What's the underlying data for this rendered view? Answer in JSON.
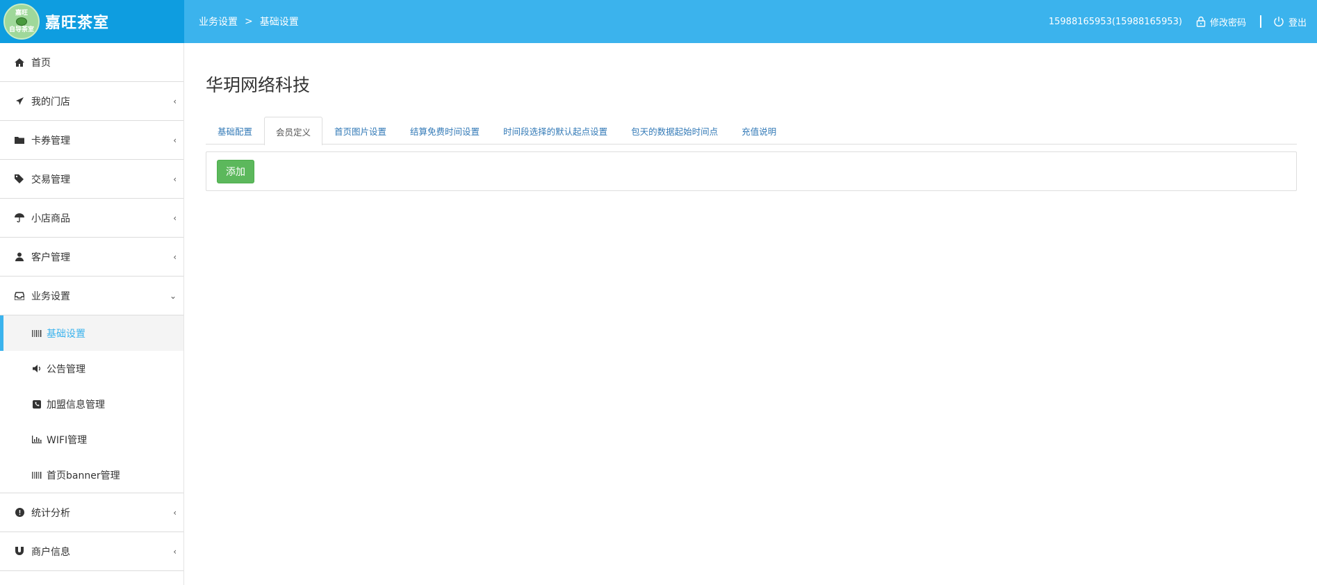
{
  "brand": {
    "logo_line1": "嘉旺",
    "logo_line2": "自导茶室",
    "title": "嘉旺茶室"
  },
  "breadcrumb": {
    "parent": "业务设置",
    "separator": ">",
    "current": "基础设置"
  },
  "topbar": {
    "user": "15988165953(15988165953)",
    "change_password": "修改密码",
    "logout": "登出"
  },
  "sidebar": {
    "home": "首页",
    "items": [
      {
        "label": "我的门店",
        "icon": "plane-icon"
      },
      {
        "label": "卡券管理",
        "icon": "folder-icon"
      },
      {
        "label": "交易管理",
        "icon": "tags-icon"
      },
      {
        "label": "小店商品",
        "icon": "umbrella-icon"
      },
      {
        "label": "客户管理",
        "icon": "user-icon"
      },
      {
        "label": "业务设置",
        "icon": "inbox-icon",
        "expanded": true
      }
    ],
    "sub_items": [
      {
        "label": "基础设置",
        "icon": "barcode-icon",
        "active": true
      },
      {
        "label": "公告管理",
        "icon": "volume-icon"
      },
      {
        "label": "加盟信息管理",
        "icon": "phone-icon"
      },
      {
        "label": "WIFI管理",
        "icon": "bar-chart-icon"
      },
      {
        "label": "首页banner管理",
        "icon": "barcode-icon"
      }
    ],
    "bottom_items": [
      {
        "label": "统计分析",
        "icon": "exclamation-icon"
      },
      {
        "label": "商户信息",
        "icon": "magnet-icon"
      }
    ]
  },
  "page": {
    "title": "华玥网络科技"
  },
  "tabs": [
    "基础配置",
    "会员定义",
    "首页图片设置",
    "结算免费时间设置",
    "时间段选择的默认起点设置",
    "包天的数据起始时间点",
    "充值说明"
  ],
  "active_tab": "会员定义",
  "actions": {
    "add": "添加"
  },
  "colors": {
    "brand": "#0e9de0",
    "topbar": "#3bb3ed",
    "active": "#3bb3ed",
    "add_button": "#5cb85c"
  }
}
